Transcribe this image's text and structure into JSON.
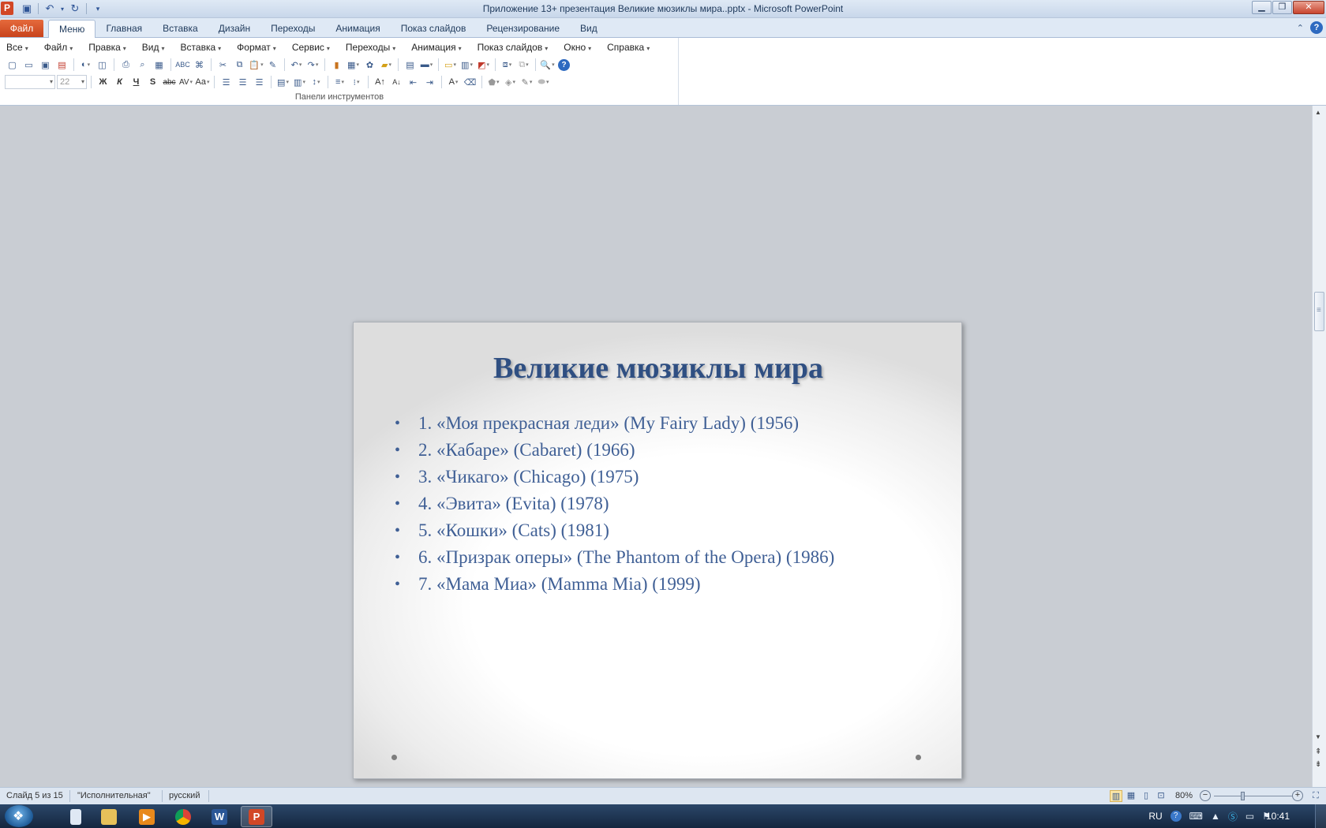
{
  "window": {
    "title": "Приложение 13+ презентация Великие мюзиклы мира..pptx - Microsoft PowerPoint",
    "app_icon": "P"
  },
  "ribbon_tabs": {
    "file": "Файл",
    "items": [
      "Меню",
      "Главная",
      "Вставка",
      "Дизайн",
      "Переходы",
      "Анимация",
      "Показ слайдов",
      "Рецензирование",
      "Вид"
    ]
  },
  "menu_bar": [
    "Все",
    "Файл",
    "Правка",
    "Вид",
    "Вставка",
    "Формат",
    "Сервис",
    "Переходы",
    "Анимация",
    "Показ слайдов",
    "Окно",
    "Справка"
  ],
  "toolbar": {
    "font_size": "22",
    "group_label": "Панели инструментов",
    "bold": "Ж",
    "italic": "К",
    "underline": "Ч",
    "shadow": "S",
    "strike": "abc",
    "spacing": "AV",
    "case": "Aa"
  },
  "slide": {
    "title": "Великие мюзиклы мира",
    "items": [
      "1. «Моя прекрасная леди» (My Fairy Lady) (1956)",
      "2. «Кабаре» (Cabaret) (1966)",
      "3. «Чикаго» (Chicago) (1975)",
      "4. «Эвита» (Evita) (1978)",
      "5. «Кошки» (Cats) (1981)",
      "6. «Призрак оперы» (The Phantom of the Opera) (1986)",
      "7. «Мама Миа» (Mamma Mia) (1999)"
    ],
    "bullet": "•"
  },
  "status": {
    "slide": "Слайд 5 из 15",
    "theme": "\"Исполнительная\"",
    "language": "русский",
    "zoom": "80%"
  },
  "taskbar": {
    "lang": "RU",
    "time": "10:41"
  },
  "colors": {
    "title": "#2f4f82",
    "body": "#3f5f95",
    "file_tab": "#d24726"
  }
}
